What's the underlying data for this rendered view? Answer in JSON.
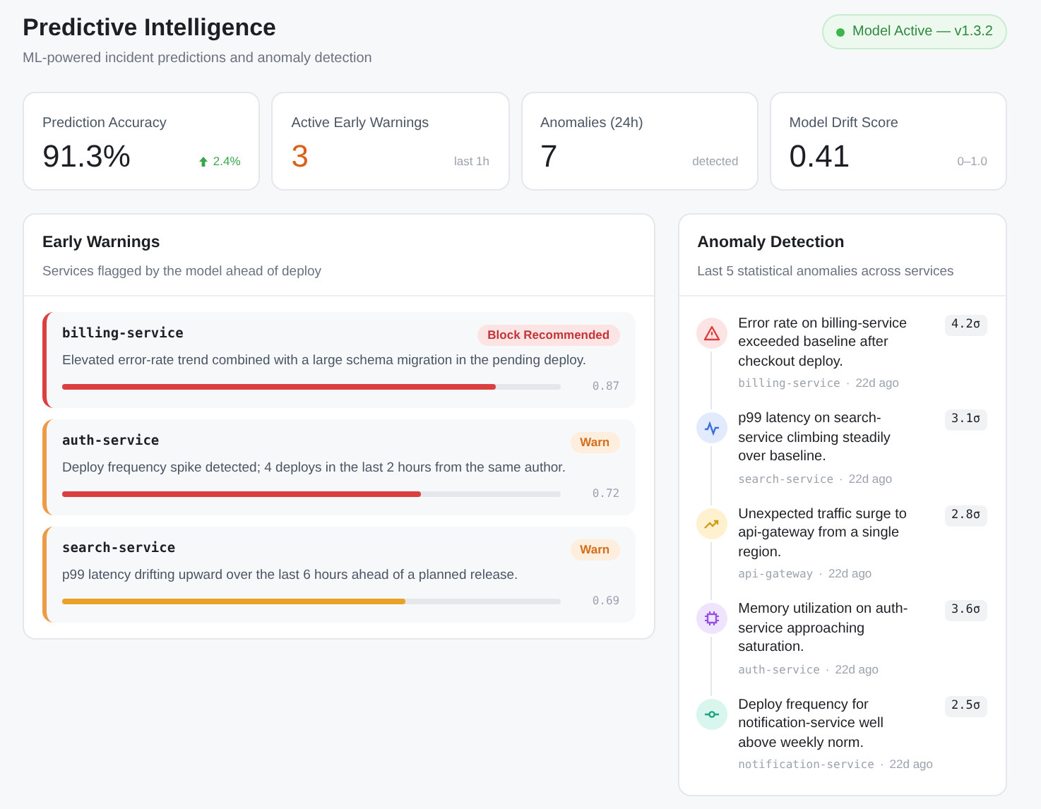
{
  "header": {
    "title": "Predictive Intelligence",
    "subtitle": "ML-powered incident predictions and anomaly detection",
    "status": {
      "label": "Model Active — v1.3.2",
      "on": true
    }
  },
  "stats": [
    {
      "label": "Prediction Accuracy",
      "value": "91.3%",
      "note": "2.4%",
      "kind": "delta"
    },
    {
      "label": "Active Early Warnings",
      "value": "3",
      "note": "last 1h",
      "kind": "alert"
    },
    {
      "label": "Anomalies (24h)",
      "value": "7",
      "note": "detected",
      "kind": "plain"
    },
    {
      "label": "Model Drift Score",
      "value": "0.41",
      "note": "0–1.0",
      "kind": "plain"
    }
  ],
  "warnings": {
    "title": "Early Warnings",
    "subtitle": "Services flagged by the model ahead of deploy",
    "items": [
      {
        "service": "billing-service",
        "tag": "Block Recommended",
        "kind": "block",
        "text": "Elevated error-rate trend combined with a large schema migration in the pending deploy.",
        "level": 0.87,
        "score": "0.87",
        "color": "#dc3f3f"
      },
      {
        "service": "auth-service",
        "tag": "Warn",
        "kind": "warn",
        "text": "Deploy frequency spike detected; 4 deploys in the last 2 hours from the same author.",
        "level": 0.72,
        "score": "0.72",
        "color": "#dc3f3f"
      },
      {
        "service": "search-service",
        "tag": "Warn",
        "kind": "warn",
        "text": "p99 latency drifting upward over the last 6 hours ahead of a planned release.",
        "level": 0.69,
        "score": "0.69",
        "color": "#e9a126"
      }
    ]
  },
  "anomalies": {
    "title": "Anomaly Detection",
    "subtitle": "Last 5 statistical anomalies across services",
    "items": [
      {
        "kind": "alert",
        "text": "Error rate on billing-service exceeded baseline after checkout deploy.",
        "service": "billing-service",
        "separator": "·",
        "time": "22d ago",
        "sigma": "4.2σ"
      },
      {
        "kind": "pulse",
        "text": "p99 latency on search-service climbing steadily over baseline.",
        "service": "search-service",
        "separator": "·",
        "time": "22d ago",
        "sigma": "3.1σ"
      },
      {
        "kind": "trend",
        "text": "Unexpected traffic surge to api-gateway from a single region.",
        "service": "api-gateway",
        "separator": "·",
        "time": "22d ago",
        "sigma": "2.8σ"
      },
      {
        "kind": "chip",
        "text": "Memory utilization on auth-service approaching saturation.",
        "service": "auth-service",
        "separator": "·",
        "time": "22d ago",
        "sigma": "3.6σ"
      },
      {
        "kind": "commit",
        "text": "Deploy frequency for notification-service well above weekly norm.",
        "service": "notification-service",
        "separator": "·",
        "time": "22d ago",
        "sigma": "2.5σ"
      }
    ]
  }
}
